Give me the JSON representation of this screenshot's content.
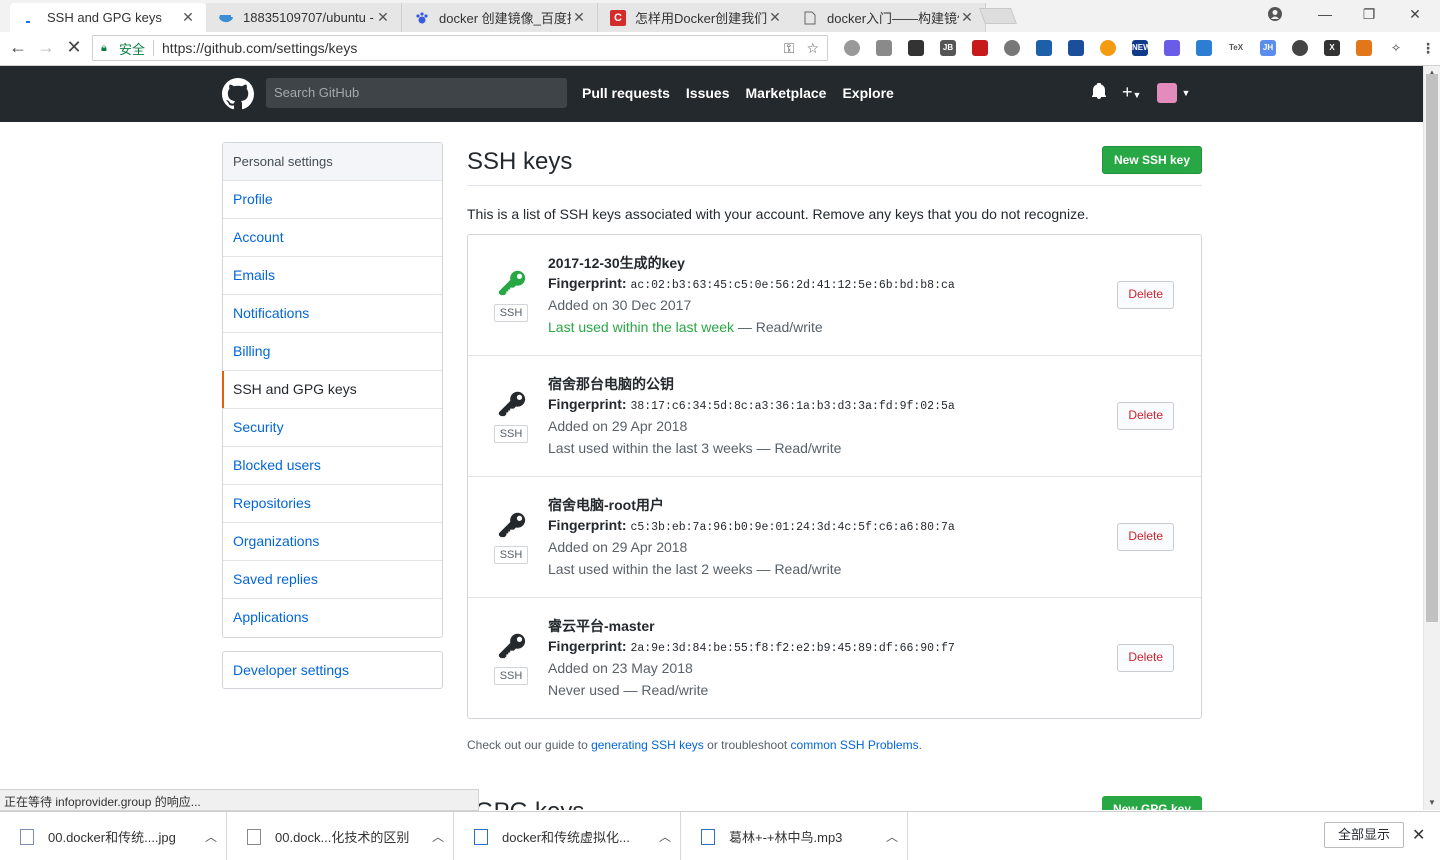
{
  "browser": {
    "tabs": [
      {
        "title": "SSH and GPG keys",
        "active": true,
        "icon": "loading-icon"
      },
      {
        "title": "18835109707/ubuntu -",
        "active": false,
        "icon": "docker-whale-icon"
      },
      {
        "title": "docker 创建镜像_百度搜",
        "active": false,
        "icon": "baidu-paw-icon"
      },
      {
        "title": "怎样用Docker创建我们自",
        "active": false,
        "icon": "csdn-icon"
      },
      {
        "title": "docker入门——构建镜像",
        "active": false,
        "icon": "page-icon"
      }
    ],
    "address": {
      "secure_label": "安全",
      "url": "https://github.com/settings/keys"
    }
  },
  "github": {
    "search_placeholder": "Search GitHub",
    "nav": [
      "Pull requests",
      "Issues",
      "Marketplace",
      "Explore"
    ]
  },
  "sidebar": {
    "heading": "Personal settings",
    "items": [
      "Profile",
      "Account",
      "Emails",
      "Notifications",
      "Billing",
      "SSH and GPG keys",
      "Security",
      "Blocked users",
      "Repositories",
      "Organizations",
      "Saved replies",
      "Applications"
    ],
    "selected": "SSH and GPG keys",
    "developer": "Developer settings"
  },
  "main": {
    "title": "SSH keys",
    "new_button": "New SSH key",
    "intro": "This is a list of SSH keys associated with your account. Remove any keys that you do not recognize.",
    "fingerprint_label": "Fingerprint:",
    "badge": "SSH",
    "delete_label": "Delete",
    "keys": [
      {
        "title": "2017-12-30生成的key",
        "fingerprint": "ac:02:b3:63:45:c5:0e:56:2d:41:12:5e:6b:bd:b8:ca",
        "added": "Added on 30 Dec 2017",
        "used": "Last used within the last week",
        "access": " — Read/write",
        "recent": true
      },
      {
        "title": "宿舍那台电脑的公钥",
        "fingerprint": "38:17:c6:34:5d:8c:a3:36:1a:b3:d3:3a:fd:9f:02:5a",
        "added": "Added on 29 Apr 2018",
        "used": "Last used within the last 3 weeks",
        "access": " — Read/write",
        "recent": false
      },
      {
        "title": "宿舍电脑-root用户",
        "fingerprint": "c5:3b:eb:7a:96:b0:9e:01:24:3d:4c:5f:c6:a6:80:7a",
        "added": "Added on 29 Apr 2018",
        "used": "Last used within the last 2 weeks",
        "access": " — Read/write",
        "recent": false
      },
      {
        "title": "睿云平台-master",
        "fingerprint": "2a:9e:3d:84:be:55:f8:f2:e2:b9:45:89:df:66:90:f7",
        "added": "Added on 23 May 2018",
        "used": "Never used",
        "access": " — Read/write",
        "recent": false
      }
    ],
    "guide": {
      "prefix": "Check out our guide to ",
      "link1": "generating SSH keys",
      "middle": " or troubleshoot ",
      "link2": "common SSH Problems",
      "suffix": "."
    },
    "gpg_title": "GPG keys",
    "gpg_button": "New GPG key"
  },
  "status": "正在等待 infoprovider.group 的响应...",
  "downloads": {
    "items": [
      "00.docker和传统....jpg",
      "00.dock...化技术的区别",
      "docker和传统虚拟化...",
      "葛林+-+林中鸟.mp3"
    ],
    "show_all": "全部显示"
  },
  "colors": {
    "header": "#24292e",
    "link": "#0366d6",
    "primary": "#28a745",
    "danger": "#cb2431",
    "selected_marker": "#e36209"
  }
}
